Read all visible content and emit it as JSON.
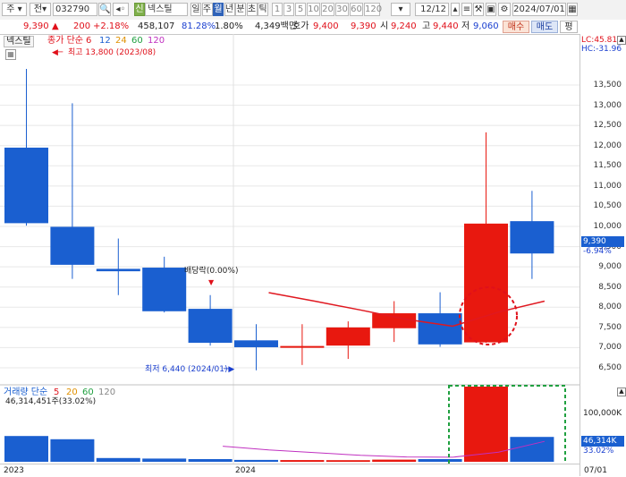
{
  "toolbar": {
    "market_label": "주",
    "type_label": "전",
    "code": "032790",
    "stock_name": "넥스틸",
    "stock_badge": "신",
    "period_tabs": [
      "일",
      "주",
      "월",
      "년",
      "분",
      "초",
      "틱"
    ],
    "period_active": 2,
    "intervals": [
      "1",
      "3",
      "5",
      "10",
      "20",
      "30",
      "60",
      "120"
    ],
    "count_value": "12",
    "count_total": "/12",
    "date_value": "2024/07/01"
  },
  "quote": {
    "price": "9,390",
    "change": "200",
    "change_pct": "+2.18%",
    "volume": "458,107",
    "volume_ratio": "81.28%",
    "turnover_pct": "1.80%",
    "trade_value": "4,349백만",
    "ask_label": "호가",
    "ask_sell": "9,400",
    "ask_buy": "9,390",
    "open_label": "시",
    "open": "9,240",
    "high_label": "고",
    "high": "9,440",
    "low_label": "저",
    "low": "9,060",
    "buy_button": "매수",
    "sell_button": "매도",
    "extra_button": "평"
  },
  "legend": {
    "name_tag": "넥스틸",
    "ma_title": "종가 단순",
    "ma_periods": [
      "6",
      "12",
      "24",
      "60",
      "120"
    ],
    "max_note": "최고 13,800 (2023/08)",
    "min_note": "최저 6,440 (2024/01)",
    "dividend_note": "배당락(0.00%)",
    "lc_label": "LC:45.81",
    "hc_label": "HC:-31.96"
  },
  "volume_legend": {
    "title": "거래량 단순",
    "periods": [
      "5",
      "20",
      "60",
      "120"
    ],
    "value_text": "46,314,451주(33.02%)"
  },
  "axis": {
    "price_ticks": [
      "13,500",
      "13,000",
      "12,500",
      "12,000",
      "11,500",
      "11,000",
      "10,500",
      "10,000",
      "9,500",
      "9,000",
      "8,500",
      "8,000",
      "7,500",
      "7,000",
      "6,500"
    ],
    "current_price_tag": "9,390",
    "current_pct": "-6.94%",
    "volume_tick": "100,000K",
    "volume_tag": "46,314K",
    "volume_pct": "33.02%",
    "x_labels": [
      "2023",
      "2024",
      "07/01"
    ]
  },
  "colors": {
    "up": "#e8180f",
    "down": "#1a5fd0",
    "ma_line": "#e01820",
    "vol_ma": "#c030c0",
    "highlight": "#20a040"
  },
  "chart_data": {
    "type": "candlestick",
    "timeframe": "monthly",
    "ylim": [
      6300,
      13800
    ],
    "candles": [
      {
        "open": 11950,
        "high": 14200,
        "low": 10020,
        "close": 10080
      },
      {
        "open": 9990,
        "high": 13050,
        "low": 8700,
        "close": 9050
      },
      {
        "open": 8950,
        "high": 9700,
        "low": 8300,
        "close": 8890
      },
      {
        "open": 8980,
        "high": 9250,
        "low": 7870,
        "close": 7900
      },
      {
        "open": 7960,
        "high": 8300,
        "low": 7050,
        "close": 7120
      },
      {
        "open": 7180,
        "high": 7580,
        "low": 6440,
        "close": 7010
      },
      {
        "open": 7010,
        "high": 7580,
        "low": 6570,
        "close": 7040
      },
      {
        "open": 7050,
        "high": 7650,
        "low": 6720,
        "close": 7500
      },
      {
        "open": 7480,
        "high": 8150,
        "low": 7140,
        "close": 7850
      },
      {
        "open": 7850,
        "high": 8370,
        "low": 7020,
        "close": 7080
      },
      {
        "open": 7130,
        "high": 12330,
        "low": 7120,
        "close": 10070
      },
      {
        "open": 10130,
        "high": 10880,
        "low": 8700,
        "close": 9330
      }
    ],
    "ma6": [
      null,
      null,
      null,
      null,
      null,
      8360,
      8150,
      7930,
      7700,
      7530,
      7880,
      8150
    ],
    "volumes_k": [
      48000,
      42000,
      7000,
      6000,
      5000,
      3500,
      3200,
      3000,
      4000,
      5000,
      140000,
      46314
    ],
    "vol_ma": [
      null,
      null,
      null,
      null,
      29000,
      22000,
      17000,
      12000,
      9000,
      8500,
      18000,
      38000
    ]
  }
}
